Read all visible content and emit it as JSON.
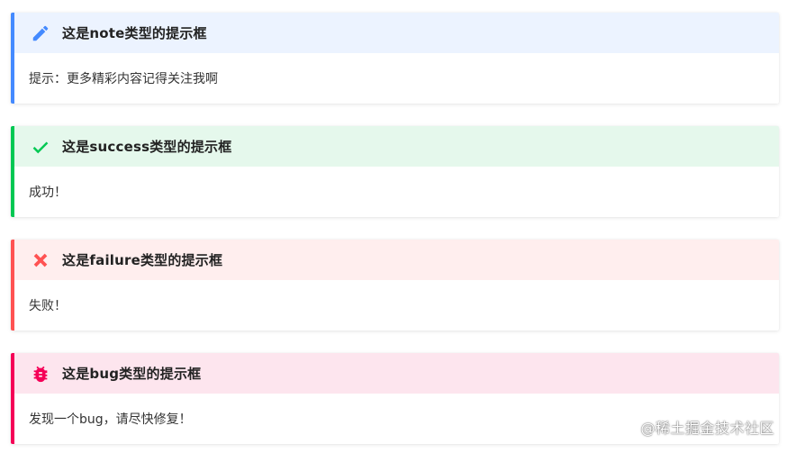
{
  "admonitions": [
    {
      "type": "note",
      "icon": "pencil-icon",
      "color": "#448aff",
      "title": "这是note类型的提示框",
      "body": "提示：更多精彩内容记得关注我啊"
    },
    {
      "type": "success",
      "icon": "check-icon",
      "color": "#00c853",
      "title": "这是success类型的提示框",
      "body": "成功！"
    },
    {
      "type": "failure",
      "icon": "cross-icon",
      "color": "#ff5252",
      "title": "这是failure类型的提示框",
      "body": "失败！"
    },
    {
      "type": "bug",
      "icon": "bug-icon",
      "color": "#f50057",
      "title": "这是bug类型的提示框",
      "body": "发现一个bug，请尽快修复！"
    }
  ],
  "watermark": "@稀土掘金技术社区"
}
